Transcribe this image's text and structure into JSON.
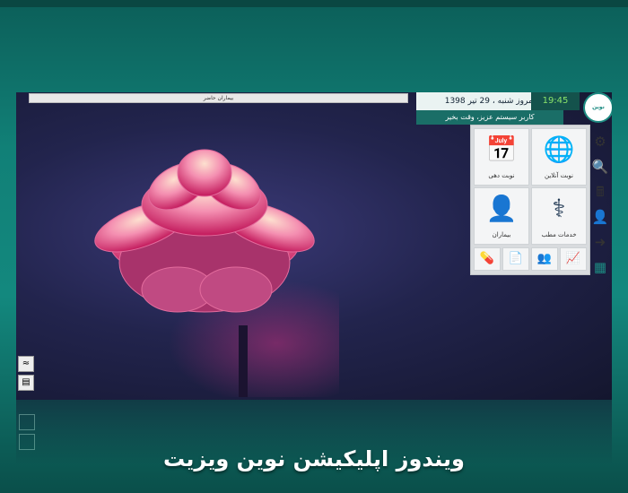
{
  "topbar": {
    "current_patients_label": "بیماران حاضر"
  },
  "status": {
    "time": "19:45",
    "date": "امروز شنبه ، 29 تیر 1398",
    "greeting": "کاربر سیستم عزیز، وقت بخیر",
    "logo_text": "نوین ویزیت"
  },
  "tiles": [
    {
      "label": "نوبت آنلاین",
      "icon": "globe-icon"
    },
    {
      "label": "نوبت دهی",
      "icon": "calendar-clock-icon"
    },
    {
      "label": "خدمات مطب",
      "icon": "doctor-icon"
    },
    {
      "label": "بیماران",
      "icon": "patient-icon"
    }
  ],
  "mini_tiles": [
    "chart-icon",
    "users-icon",
    "document-icon",
    "medical-user-icon"
  ],
  "side_icons": [
    "gear-icon",
    "search-icon",
    "calculator-icon",
    "user-icon",
    "logout-icon",
    "id-card-icon"
  ],
  "bottom_left_icons": [
    "wifi-icon",
    "form-icon"
  ],
  "caption": "ویندوز اپلیکیشن نوین ویزیت"
}
